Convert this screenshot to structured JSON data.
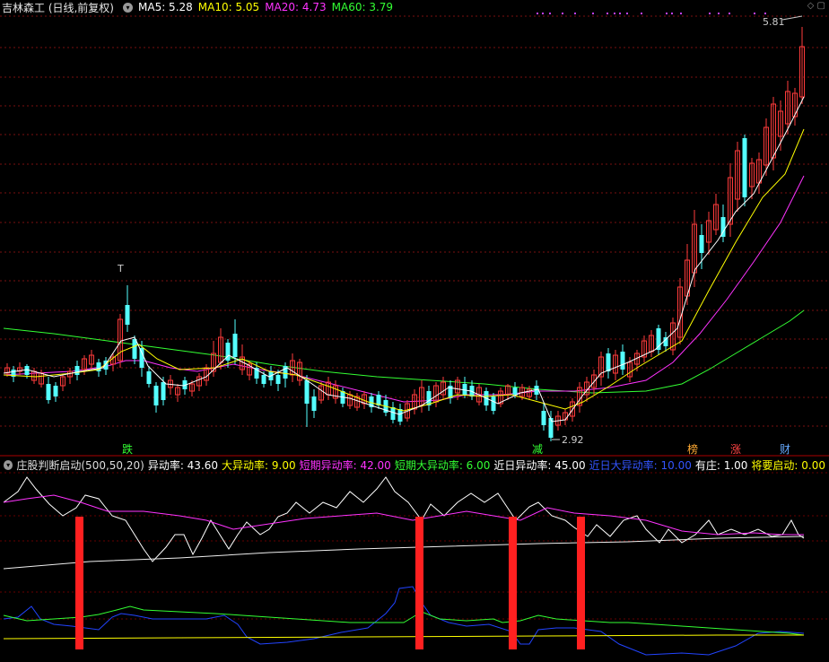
{
  "header": {
    "title": "吉林森工 (日线,前复权)",
    "ma": [
      {
        "label": "MA5: 5.28",
        "color": "#ffffff"
      },
      {
        "label": "MA10: 5.05",
        "color": "#ffff00"
      },
      {
        "label": "MA20: 4.73",
        "color": "#ff33ff"
      },
      {
        "label": "MA60: 3.79",
        "color": "#33ff33"
      }
    ]
  },
  "price_chart": {
    "high_label": "5.81",
    "low_label": "2.92",
    "top_marker": "T",
    "signals": [
      {
        "text": "跌",
        "color": "#33ff33"
      },
      {
        "text": "减",
        "color": "#33ff33"
      },
      {
        "text": "榜",
        "color": "#ffaa33"
      },
      {
        "text": "涨",
        "color": "#ff4444"
      },
      {
        "text": "财",
        "color": "#66aaff"
      }
    ]
  },
  "indicator": {
    "name": "庄股判断启动(500,50,20)",
    "items": [
      {
        "label": "异动率: 43.60",
        "color": "#ffffff"
      },
      {
        "label": "大异动率: 9.00",
        "color": "#ffff00"
      },
      {
        "label": "短期异动率: 42.00",
        "color": "#ff33ff"
      },
      {
        "label": "短期大异动率: 6.00",
        "color": "#33ff33"
      },
      {
        "label": "近日异动率: 45.00",
        "color": "#ffffff"
      },
      {
        "label": "近日大异动率: 10.00",
        "color": "#3355ff"
      },
      {
        "label": "有庄: 1.00",
        "color": "#ffffff"
      },
      {
        "label": "将要启动: 0.00",
        "color": "#ffff00"
      }
    ]
  }
}
